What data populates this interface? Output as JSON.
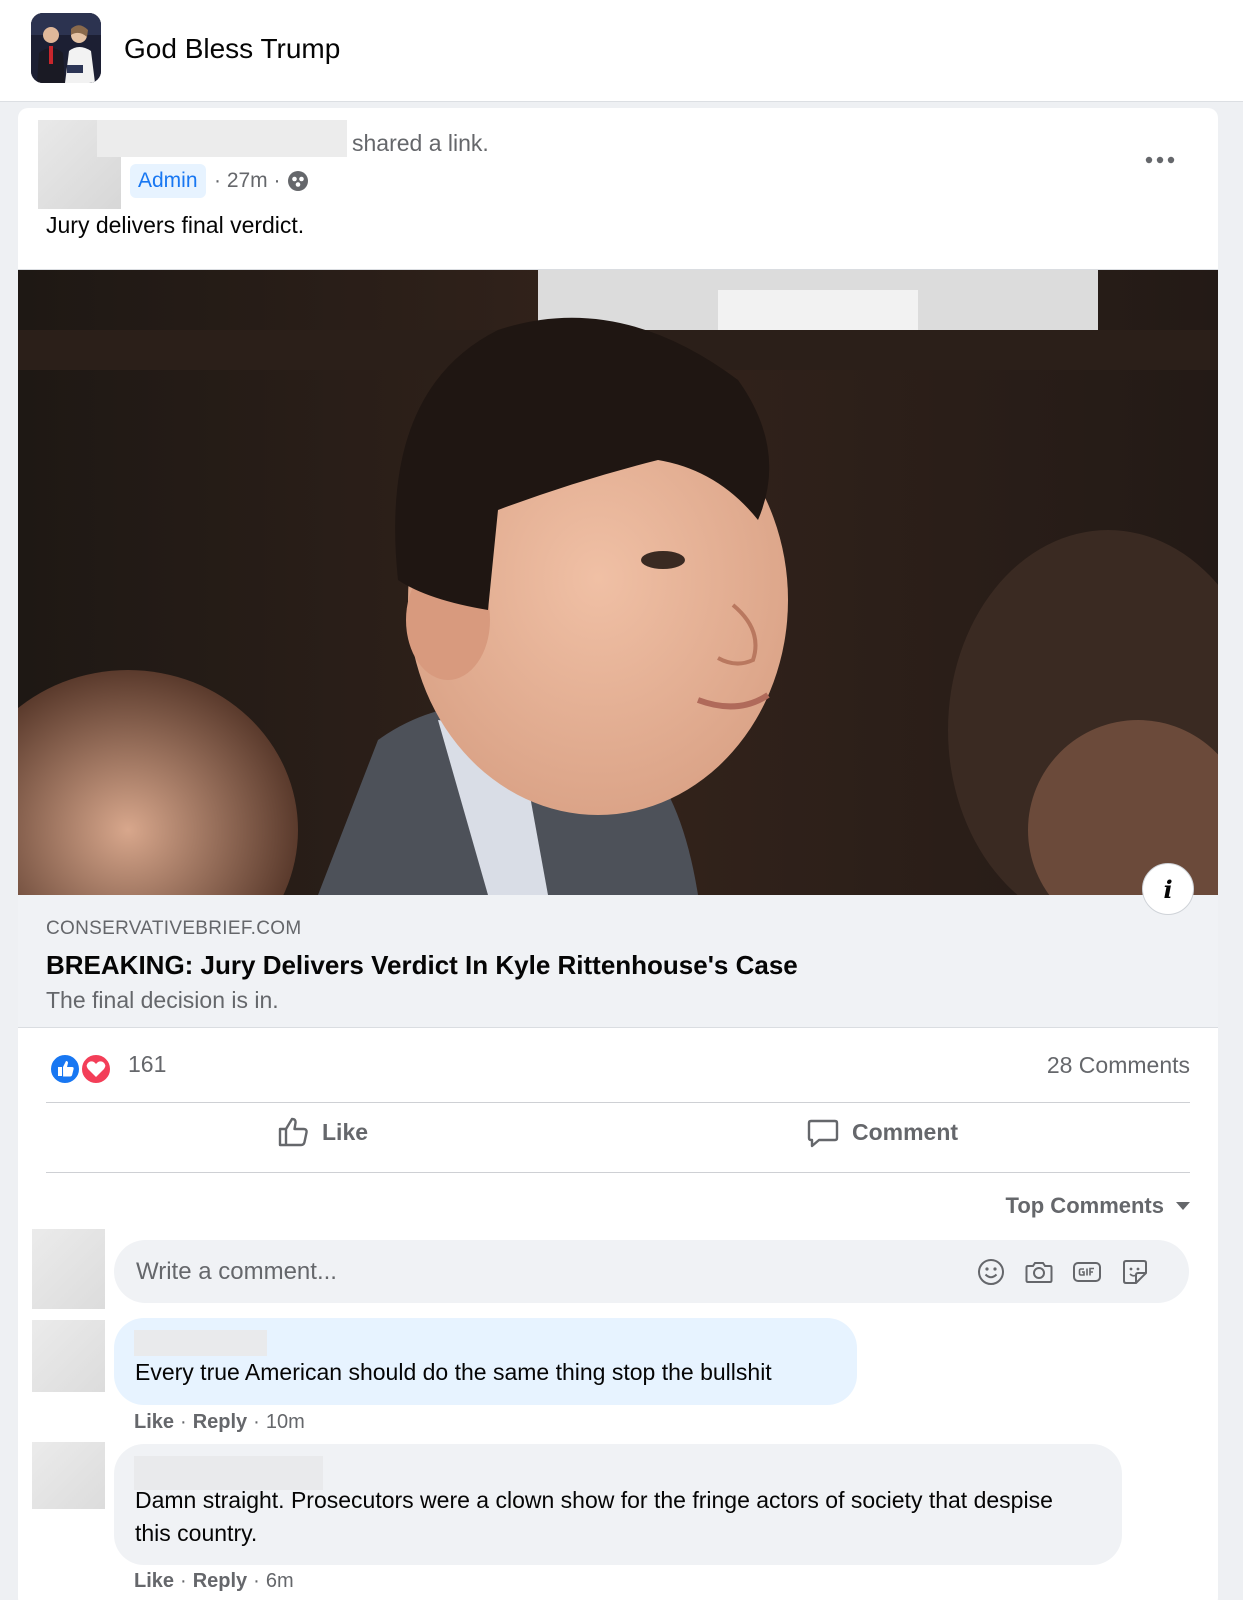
{
  "group": {
    "name": "God Bless Trump"
  },
  "post": {
    "author_action": "shared a link.",
    "badge": "Admin",
    "meta": "· 27m ·",
    "message": "Jury delivers final verdict.",
    "link": {
      "domain": "CONSERVATIVEBRIEF.COM",
      "title": "BREAKING: Jury Delivers Verdict In Kyle Rittenhouse's Case",
      "description": "The final decision is in.",
      "info_label": "i"
    },
    "stats": {
      "reactions": "161",
      "comments": "28 Comments"
    },
    "actions": {
      "like": "Like",
      "comment": "Comment"
    }
  },
  "comments_section": {
    "sort_label": "Top Comments",
    "composer_placeholder": "Write a comment...",
    "composer_icons": [
      "emoji-icon",
      "camera-icon",
      "gif-icon",
      "sticker-icon"
    ],
    "comments": [
      {
        "text": "Every true American should do the same thing stop the bullshit",
        "like": "Like",
        "reply": "Reply",
        "time": "10m",
        "highlight_color": "#e7f3ff"
      },
      {
        "text": "Damn straight. Prosecutors were a clown show for the fringe actors of society that despise this country.",
        "like": "Like",
        "reply": "Reply",
        "time": "6m",
        "highlight_color": "#f0f2f5"
      }
    ]
  },
  "colors": {
    "brand_blue": "#1877f2",
    "love_red": "#f33e58",
    "secondary_text": "#65676b"
  }
}
